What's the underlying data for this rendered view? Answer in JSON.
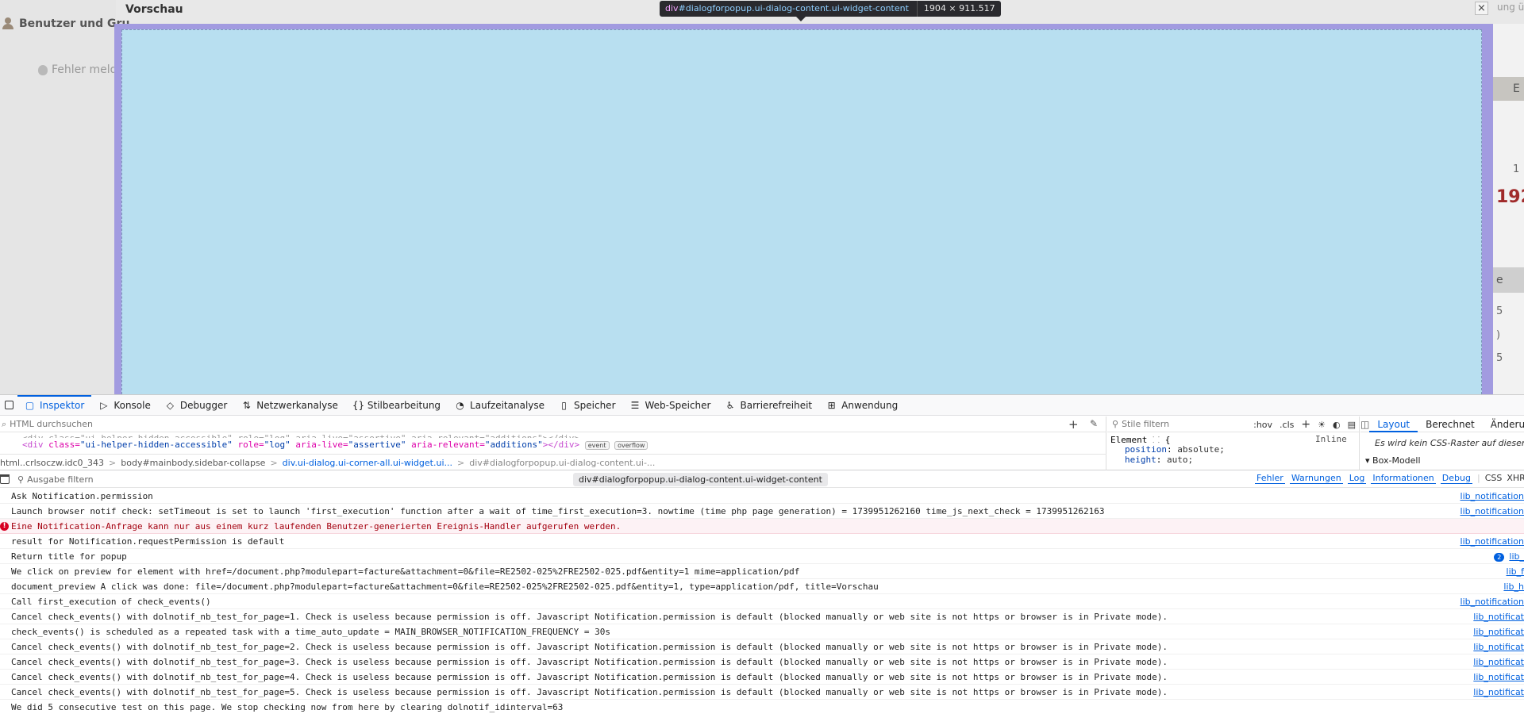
{
  "page": {
    "sidebar": {
      "user_label": "Benutzer und Gru",
      "bug_label": "Fehler melde"
    },
    "dialog": {
      "title": "Vorschau",
      "close_glyph": "×"
    },
    "right_clip": {
      "top_text": "ung ü",
      "box1": "E",
      "num1": "1",
      "big": "192",
      "box2": "e",
      "t1": "5",
      "t2": ")",
      "t3": "5"
    },
    "highlight_tooltip": {
      "tag": "div",
      "selector": "#dialogforpopup.ui-dialog-content.ui-widget-content",
      "dimensions": "1904 × 911.517"
    }
  },
  "devtools": {
    "tabs": [
      {
        "icon": "▢",
        "label": "Inspektor",
        "active": true
      },
      {
        "icon": "▷",
        "label": "Konsole"
      },
      {
        "icon": "◇",
        "label": "Debugger"
      },
      {
        "icon": "⇅",
        "label": "Netzwerkanalyse"
      },
      {
        "icon": "{}",
        "label": "Stilbearbeitung"
      },
      {
        "icon": "◔",
        "label": "Laufzeitanalyse"
      },
      {
        "icon": "▯",
        "label": "Speicher"
      },
      {
        "icon": "☰",
        "label": "Web-Speicher"
      },
      {
        "icon": "♿",
        "label": "Barrierefreiheit"
      },
      {
        "icon": "⊞",
        "label": "Anwendung"
      }
    ],
    "inspector": {
      "search_placeholder": "HTML durchsuchen",
      "markup_line1_pre": "<div class=\"ui-helper-hidden-accessible\" role=\"log\" aria-live=\"assertive\" aria-relevant=\"additions\"></div>",
      "markup_line2": {
        "tag_open": "<div",
        "attr1": " class=",
        "val1": "\"ui-helper-hidden-accessible\"",
        "attr2": " role=",
        "val2": "\"log\"",
        "attr3": " aria-live=",
        "val3": "\"assertive\"",
        "attr4": " aria-relevant=",
        "val4": "\"additions\"",
        "tag_close": "></div>"
      },
      "badges": [
        "event",
        "overflow"
      ],
      "breadcrumbs": [
        "html..crlsoczw.idc0_343",
        "body#mainbody.sidebar-collapse",
        "div.ui-dialog.ui-corner-all.ui-widget.ui...",
        "div#dialogforpopup.ui-dialog-content.ui-..."
      ]
    },
    "rules": {
      "filter_placeholder": "Stile filtern",
      "hov": ":hov",
      "cls": ".cls",
      "element_label": "Element",
      "inline_label": "Inline",
      "props": [
        {
          "name": "position",
          "value": "absolute;"
        },
        {
          "name": "height",
          "value": "auto;"
        }
      ]
    },
    "layout": {
      "tabs": [
        "Layout",
        "Berechnet",
        "Änderun"
      ],
      "active_tab": "Layout",
      "grid_note": "Es wird kein CSS-Raster auf dieser S",
      "box_model_label": "Box-Modell"
    },
    "console": {
      "filter_placeholder": "Ausgabe filtern",
      "selected_pill": "div#dialogforpopup.ui-dialog-content.ui-widget-content",
      "levels": [
        "Fehler",
        "Warnungen",
        "Log",
        "Informationen",
        "Debug"
      ],
      "extra": [
        "CSS",
        "XHR"
      ],
      "rows": [
        {
          "text": "Ask Notification.permission",
          "src": "lib_notification"
        },
        {
          "text": "Launch browser notif check: setTimeout is set to launch 'first_execution' function after a wait of time_first_execution=3. nowtime (time php page generation) = 1739951262160 time_js_next_check = 1739951262163",
          "src": "lib_notification"
        },
        {
          "text": "Eine Notification-Anfrage kann nur aus einem kurz laufenden Benutzer-generierten Ereignis-Handler aufgerufen werden.",
          "src": "",
          "error": true
        },
        {
          "text": "result for Notification.requestPermission is default",
          "src": "lib_notification"
        },
        {
          "text": "Return title for popup",
          "src": "lib_",
          "repeat": "2"
        },
        {
          "text": "We click on preview for element with href=/document.php?modulepart=facture&attachment=0&file=RE2502-025%2FRE2502-025.pdf&entity=1 mime=application/pdf",
          "src": "lib_f"
        },
        {
          "text": "document_preview A click was done: file=/document.php?modulepart=facture&attachment=0&file=RE2502-025%2FRE2502-025.pdf&entity=1, type=application/pdf, title=Vorschau",
          "src": "lib_h"
        },
        {
          "text": "Call first_execution of check_events()",
          "src": "lib_notification"
        },
        {
          "text": "Cancel check_events() with dolnotif_nb_test_for_page=1. Check is useless because permission is off. Javascript Notification.permission is default (blocked manually or web site is not https or browser is in Private mode).",
          "src": "lib_notificat"
        },
        {
          "text": "check_events() is scheduled as a repeated task with a time_auto_update = MAIN_BROWSER_NOTIFICATION_FREQUENCY = 30s",
          "src": "lib_notificat"
        },
        {
          "text": "Cancel check_events() with dolnotif_nb_test_for_page=2. Check is useless because permission is off. Javascript Notification.permission is default (blocked manually or web site is not https or browser is in Private mode).",
          "src": "lib_notificat"
        },
        {
          "text": "Cancel check_events() with dolnotif_nb_test_for_page=3. Check is useless because permission is off. Javascript Notification.permission is default (blocked manually or web site is not https or browser is in Private mode).",
          "src": "lib_notificat"
        },
        {
          "text": "Cancel check_events() with dolnotif_nb_test_for_page=4. Check is useless because permission is off. Javascript Notification.permission is default (blocked manually or web site is not https or browser is in Private mode).",
          "src": "lib_notificat"
        },
        {
          "text": "Cancel check_events() with dolnotif_nb_test_for_page=5. Check is useless because permission is off. Javascript Notification.permission is default (blocked manually or web site is not https or browser is in Private mode).",
          "src": "lib_notificat"
        },
        {
          "text": "We did 5 consecutive test on this page. We stop checking now from here by clearing dolnotif_idinterval=63",
          "src": ""
        }
      ]
    }
  }
}
